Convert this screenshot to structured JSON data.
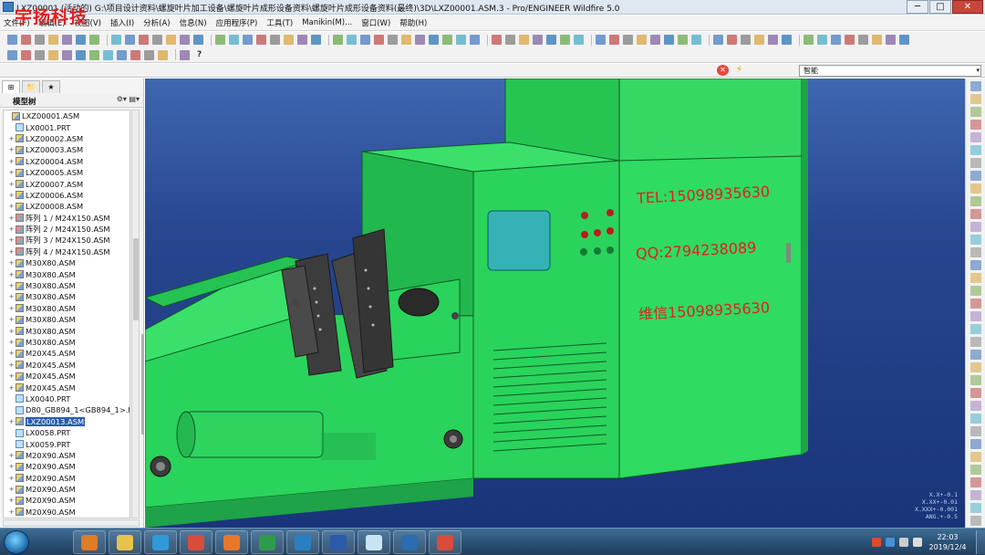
{
  "window": {
    "title": "LXZ00001 (活动的) G:\\项目设计资料\\螺旋叶片加工设备\\螺旋叶片成形设备资料\\螺旋叶片成形设备资料(最终)\\3D\\LXZ00001.ASM.3 - Pro/ENGINEER Wildfire 5.0",
    "minimize": "─",
    "maximize": "□",
    "close": "✕"
  },
  "watermark": "宇扬科技",
  "menubar": [
    "文件(F)",
    "编辑(E)",
    "视图(V)",
    "插入(I)",
    "分析(A)",
    "信息(N)",
    "应用程序(P)",
    "工具(T)",
    "Manikin(M)...",
    "窗口(W)",
    "帮助(H)"
  ],
  "filter": {
    "smart": "智能",
    "dropdown": "▾"
  },
  "left_panel": {
    "header": "模型树",
    "tools": "⚙▾ ▤▾",
    "items": [
      {
        "label": "LXZ00001.ASM",
        "type": "asm",
        "root": true
      },
      {
        "label": "LX0001.PRT",
        "type": "prt"
      },
      {
        "label": "LXZ00002.ASM",
        "type": "asm"
      },
      {
        "label": "LXZ00003.ASM",
        "type": "asm"
      },
      {
        "label": "LXZ00004.ASM",
        "type": "asm"
      },
      {
        "label": "LXZ00005.ASM",
        "type": "asm"
      },
      {
        "label": "LXZ00007.ASM",
        "type": "asm"
      },
      {
        "label": "LXZ00006.ASM",
        "type": "asm"
      },
      {
        "label": "LXZ00008.ASM",
        "type": "asm"
      },
      {
        "label": "阵列 1 / M24X150.ASM",
        "type": "pat"
      },
      {
        "label": "阵列 2 / M24X150.ASM",
        "type": "pat"
      },
      {
        "label": "阵列 3 / M24X150.ASM",
        "type": "pat"
      },
      {
        "label": "阵列 4 / M24X150.ASM",
        "type": "pat"
      },
      {
        "label": "M30X80.ASM",
        "type": "asm"
      },
      {
        "label": "M30X80.ASM",
        "type": "asm"
      },
      {
        "label": "M30X80.ASM",
        "type": "asm"
      },
      {
        "label": "M30X80.ASM",
        "type": "asm"
      },
      {
        "label": "M30X80.ASM",
        "type": "asm"
      },
      {
        "label": "M30X80.ASM",
        "type": "asm"
      },
      {
        "label": "M30X80.ASM",
        "type": "asm"
      },
      {
        "label": "M30X80.ASM",
        "type": "asm"
      },
      {
        "label": "M20X45.ASM",
        "type": "asm"
      },
      {
        "label": "M20X45.ASM",
        "type": "asm"
      },
      {
        "label": "M20X45.ASM",
        "type": "asm"
      },
      {
        "label": "M20X45.ASM",
        "type": "asm"
      },
      {
        "label": "LX0040.PRT",
        "type": "prt"
      },
      {
        "label": "D80_GB894_1<GB894_1>.P",
        "type": "prt"
      },
      {
        "label": "LXZ00013.ASM",
        "type": "asm",
        "selected": true
      },
      {
        "label": "LX0058.PRT",
        "type": "prt"
      },
      {
        "label": "LX0059.PRT",
        "type": "prt"
      },
      {
        "label": "M20X90.ASM",
        "type": "asm"
      },
      {
        "label": "M20X90.ASM",
        "type": "asm"
      },
      {
        "label": "M20X90.ASM",
        "type": "asm"
      },
      {
        "label": "M20X90.ASM",
        "type": "asm"
      },
      {
        "label": "M20X90.ASM",
        "type": "asm"
      },
      {
        "label": "M20X90.ASM",
        "type": "asm"
      }
    ]
  },
  "viewport": {
    "tel": "TEL:15098935630",
    "qq": "QQ:2794238089",
    "wechat": "维信15098935630",
    "coords": [
      "X.X+-0.1",
      "X.XX+-0.01",
      "X.XXX+-0.001",
      "ANG.+-0.5"
    ]
  },
  "taskbar": {
    "apps": [
      "media-player",
      "file-explorer",
      "ie",
      "chrome",
      "app-store",
      "excel",
      "corel",
      "word",
      "notepad",
      "proe",
      "pdf"
    ],
    "time": "22:03",
    "date": "2019/12/4"
  },
  "colors": {
    "machine": "#2ddb5c",
    "viewport_bg": "#27468f",
    "contact_text": "#e1201f"
  }
}
